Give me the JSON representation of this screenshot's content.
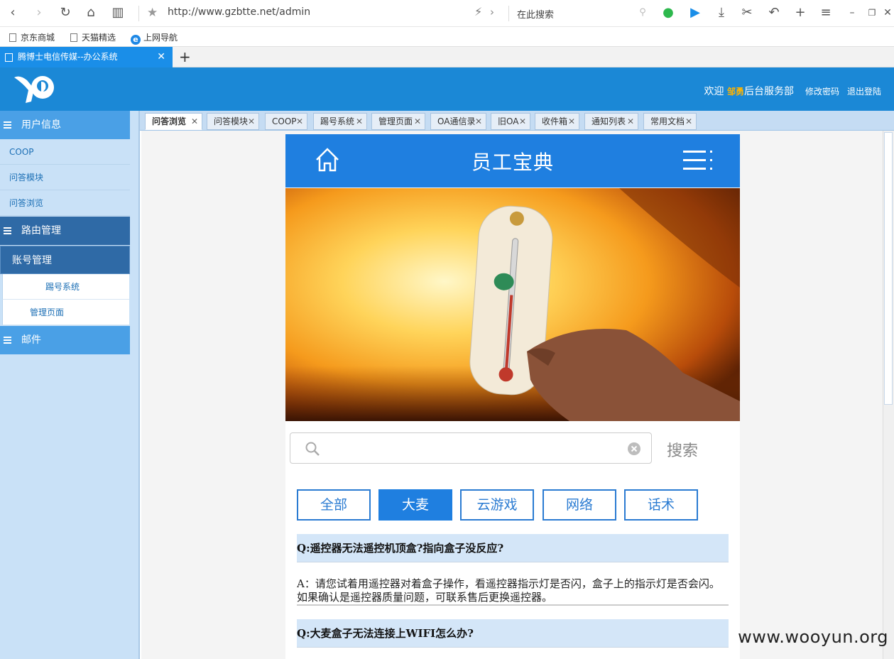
{
  "browser": {
    "url": "http://www.gzbtte.net/admin",
    "search_placeholder": "在此搜索",
    "bookmarks": [
      "京东商城",
      "天猫精选",
      "上网导航"
    ],
    "tab_title": "腾博士电信传媒--办公系统"
  },
  "header": {
    "welcome_prefix": "欢迎",
    "user_name": "邹勇",
    "welcome_suffix": "后台服务部",
    "change_password": "修改密码",
    "logout": "退出登陆",
    "color": "#1b88d6"
  },
  "sidebar": {
    "sections": [
      "用户信息",
      "路由管理",
      "邮件"
    ],
    "user_items": [
      "COOP",
      "问答模块",
      "问答浏览"
    ],
    "account_head": "账号管理",
    "account_items": [
      "踢号系统",
      "管理页面"
    ]
  },
  "content_tabs": [
    "问答浏览",
    "问答模块",
    "COOP",
    "踢号系统",
    "管理页面",
    "OA通信录",
    "旧OA",
    "收件箱",
    "通知列表",
    "常用文档"
  ],
  "page": {
    "title": "员工宝典",
    "search_button": "搜索",
    "categories": [
      "全部",
      "大麦",
      "云游戏",
      "网络",
      "话术"
    ],
    "active_category": "大麦",
    "q1": "Q:遥控器无法遥控机顶盒?指向盒子没反应?",
    "a1": "A：请您试着用遥控器对着盒子操作，看遥控器指示灯是否闪，盒子上的指示灯是否会闪。如果确认是遥控器质量问题，可联系售后更换遥控器。",
    "q2": "Q:大麦盒子无法连接上WIFI怎么办?",
    "accent": "#1f7fe0"
  },
  "watermark": "www.wooyun.org"
}
